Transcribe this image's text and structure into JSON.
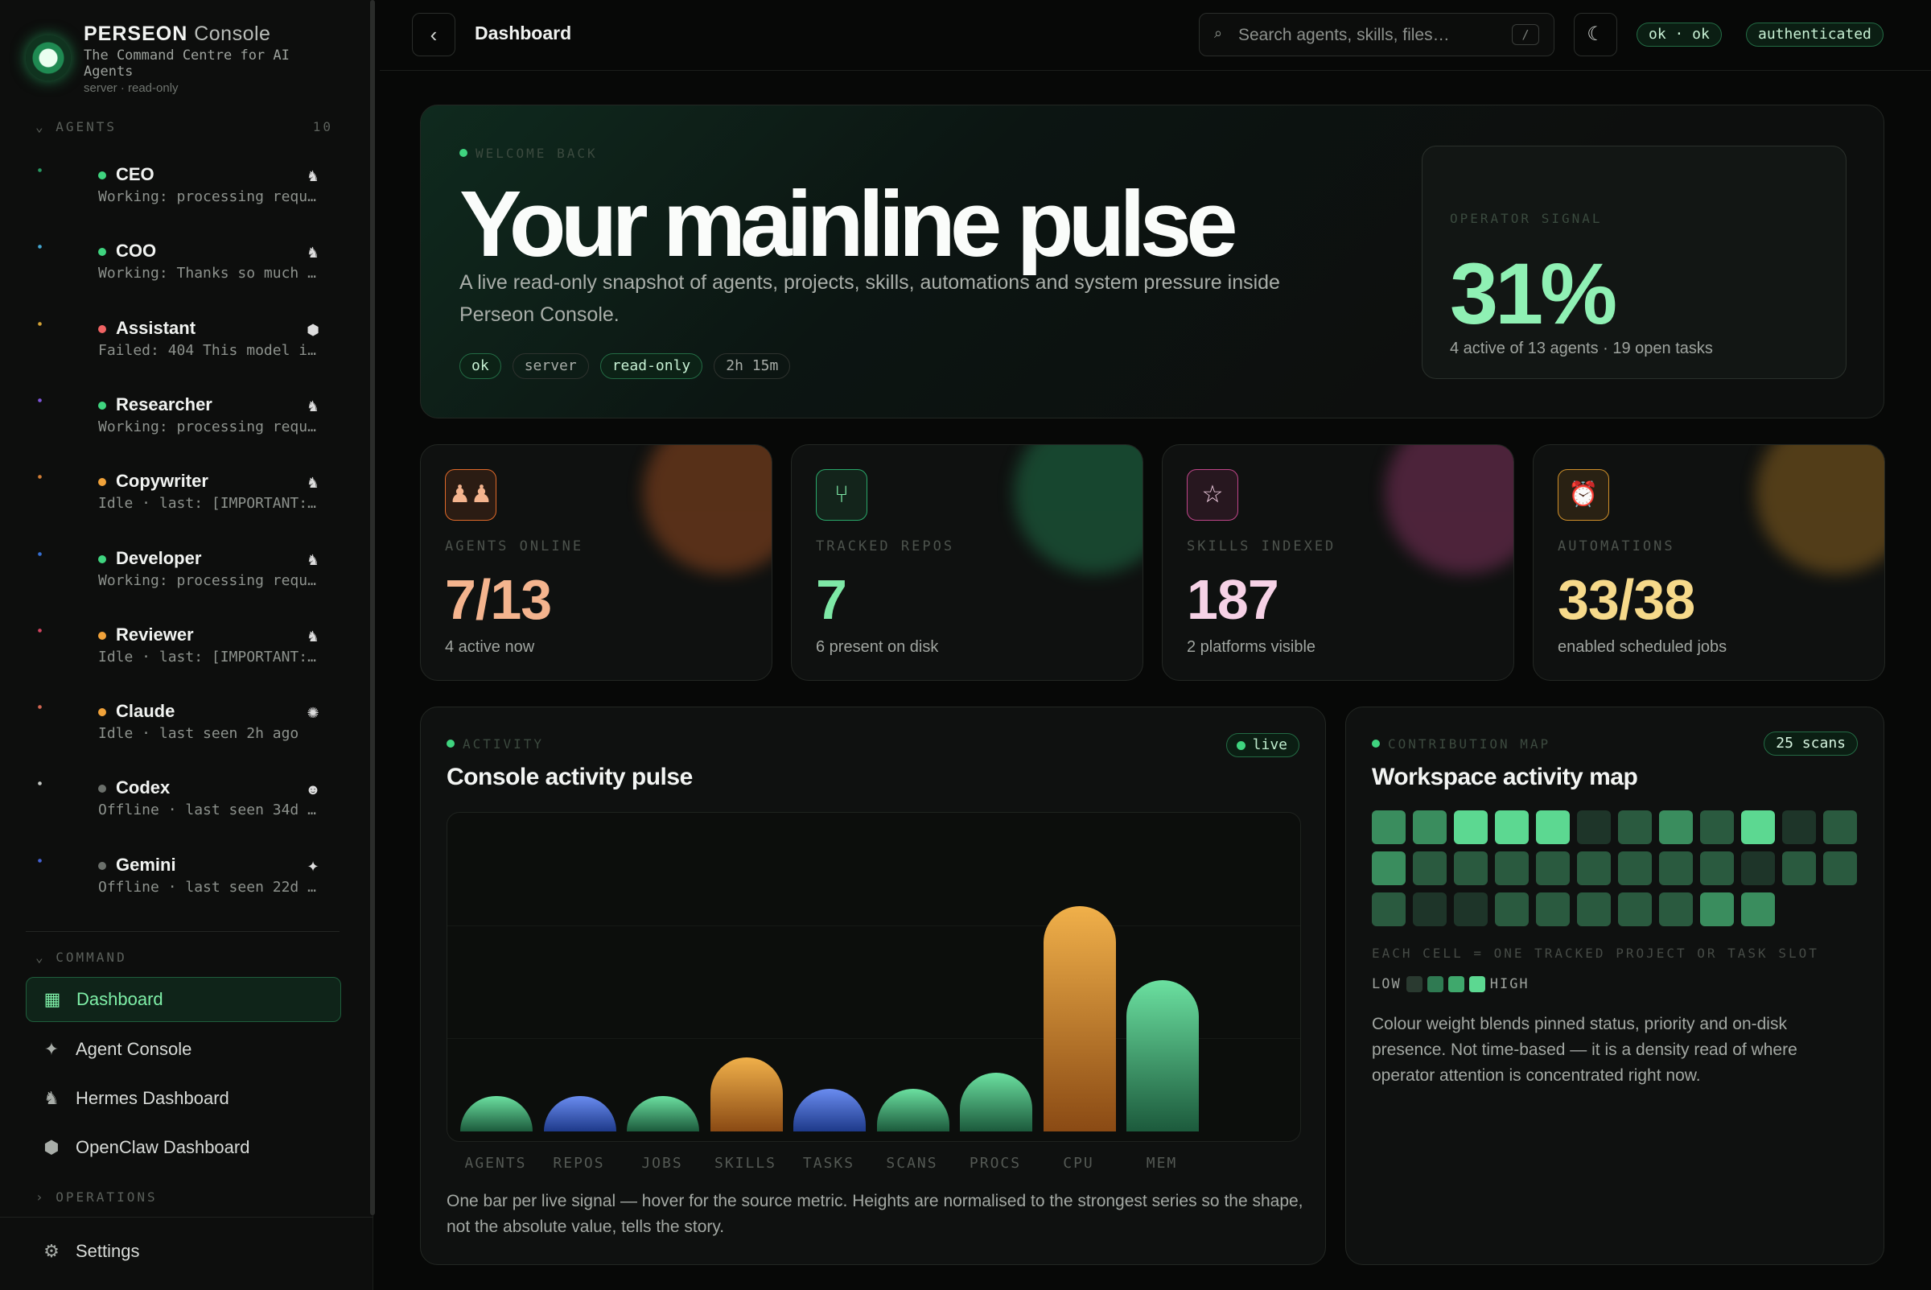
{
  "brand": {
    "name": "PERSEON",
    "name_sub": "Console",
    "tagline": "The Command Centre for AI Agents",
    "mode": "server · read-only"
  },
  "sidebar": {
    "agents_header": "AGENTS",
    "agents_count": "10",
    "agents": [
      {
        "name": "CEO",
        "status": "Working: processing requ…",
        "dot": "#3fd47f",
        "badge": "♞",
        "avatar_color": "#2aa86a"
      },
      {
        "name": "COO",
        "status": "Working: Thanks so much …",
        "dot": "#3fd47f",
        "badge": "♞",
        "avatar_color": "#4ab8e8"
      },
      {
        "name": "Assistant",
        "status": "Failed: 404 This model i…",
        "dot": "#f06363",
        "badge": "⬢",
        "avatar_color": "#e8b23a"
      },
      {
        "name": "Researcher",
        "status": "Working: processing requ…",
        "dot": "#3fd47f",
        "badge": "♞",
        "avatar_color": "#8a5cf0"
      },
      {
        "name": "Copywriter",
        "status": "Idle · last: [IMPORTANT:…",
        "dot": "#f0a23a",
        "badge": "♞",
        "avatar_color": "#e88a3a"
      },
      {
        "name": "Developer",
        "status": "Working: processing requ…",
        "dot": "#3fd47f",
        "badge": "♞",
        "avatar_color": "#3a7ae8"
      },
      {
        "name": "Reviewer",
        "status": "Idle · last: [IMPORTANT:…",
        "dot": "#f0a23a",
        "badge": "♞",
        "avatar_color": "#e84a6a"
      },
      {
        "name": "Claude",
        "status": "Idle · last seen 2h ago",
        "dot": "#f0a23a",
        "badge": "✺",
        "avatar_color": "#e8705a"
      },
      {
        "name": "Codex",
        "status": "Offline · last seen 34d …",
        "dot": "#6b706b",
        "badge": "☻",
        "avatar_color": "#d8dcd8"
      },
      {
        "name": "Gemini",
        "status": "Offline · last seen 22d …",
        "dot": "#6b706b",
        "badge": "✦",
        "avatar_color": "#4a6ae8"
      }
    ],
    "command_header": "COMMAND",
    "nav": [
      {
        "label": "Dashboard",
        "icon": "▦"
      },
      {
        "label": "Agent Console",
        "icon": "✦"
      },
      {
        "label": "Hermes Dashboard",
        "icon": "♞"
      },
      {
        "label": "OpenClaw Dashboard",
        "icon": "⬢"
      }
    ],
    "operations_header": "OPERATIONS",
    "settings_label": "Settings"
  },
  "topbar": {
    "back": "‹",
    "breadcrumb": "Dashboard",
    "search_placeholder": "Search agents, skills, files…",
    "search_kbd": "/",
    "status_pill": "ok · ok",
    "auth_pill": "authenticated"
  },
  "hero": {
    "eyebrow": "WELCOME BACK",
    "title": "Your mainline pulse",
    "description": "A live read-only snapshot of agents, projects, skills, automations and system pressure inside Perseon Console.",
    "tags": [
      "ok",
      "server",
      "read-only",
      "2h 15m"
    ],
    "signal": {
      "eyebrow": "OPERATOR SIGNAL",
      "value": "31%",
      "sub": "4 active of 13 agents · 19 open tasks"
    }
  },
  "kpis": [
    {
      "label": "AGENTS ONLINE",
      "value": "7/13",
      "caption": "4 active now",
      "color": "#f4b48e",
      "accent": "#e06a2a",
      "icon": "♟♟"
    },
    {
      "label": "TRACKED REPOS",
      "value": "7",
      "caption": "6 present on disk",
      "color": "#7ee8a6",
      "accent": "#2aa86a",
      "icon": "⑂"
    },
    {
      "label": "SKILLS INDEXED",
      "value": "187",
      "caption": "2 platforms visible",
      "color": "#f6d2e6",
      "accent": "#c0468a",
      "icon": "☆"
    },
    {
      "label": "AUTOMATIONS",
      "value": "33/38",
      "caption": "enabled scheduled jobs",
      "color": "#f6d98a",
      "accent": "#d0902a",
      "icon": "⏰"
    }
  ],
  "activity": {
    "eyebrow": "ACTIVITY",
    "title": "Console activity pulse",
    "live": "live",
    "footnote": "One bar per live signal — hover for the source metric. Heights are normalised to the strongest series so the shape, not the absolute value, tells the story."
  },
  "chart_data": {
    "type": "bar",
    "title": "Console activity pulse",
    "categories": [
      "AGENTS",
      "REPOS",
      "JOBS",
      "SKILLS",
      "TASKS",
      "SCANS",
      "PROCS",
      "CPU",
      "MEM"
    ],
    "values": [
      0.15,
      0.15,
      0.15,
      0.33,
      0.19,
      0.19,
      0.26,
      1.0,
      0.67
    ],
    "colors": [
      "green",
      "blue",
      "green",
      "orange",
      "blue",
      "green",
      "green",
      "orange",
      "green",
      "green"
    ],
    "ylim": [
      0,
      1
    ]
  },
  "map": {
    "eyebrow": "CONTRIBUTION MAP",
    "title": "Workspace activity map",
    "scans": "25 scans",
    "cells": [
      3,
      3,
      4,
      4,
      4,
      1,
      2,
      3,
      2,
      4,
      1,
      2,
      3,
      2,
      2,
      2,
      2,
      2,
      2,
      2,
      2,
      1,
      2,
      2,
      2,
      1,
      1,
      2,
      2,
      2,
      2,
      2,
      3,
      3
    ],
    "note": "EACH CELL = ONE TRACKED PROJECT OR TASK SLOT",
    "legend_low": "LOW",
    "legend_high": "HIGH",
    "description": "Colour weight blends pinned status, priority and on-disk presence. Not time-based — it is a density read of where operator attention is concentrated right now."
  }
}
